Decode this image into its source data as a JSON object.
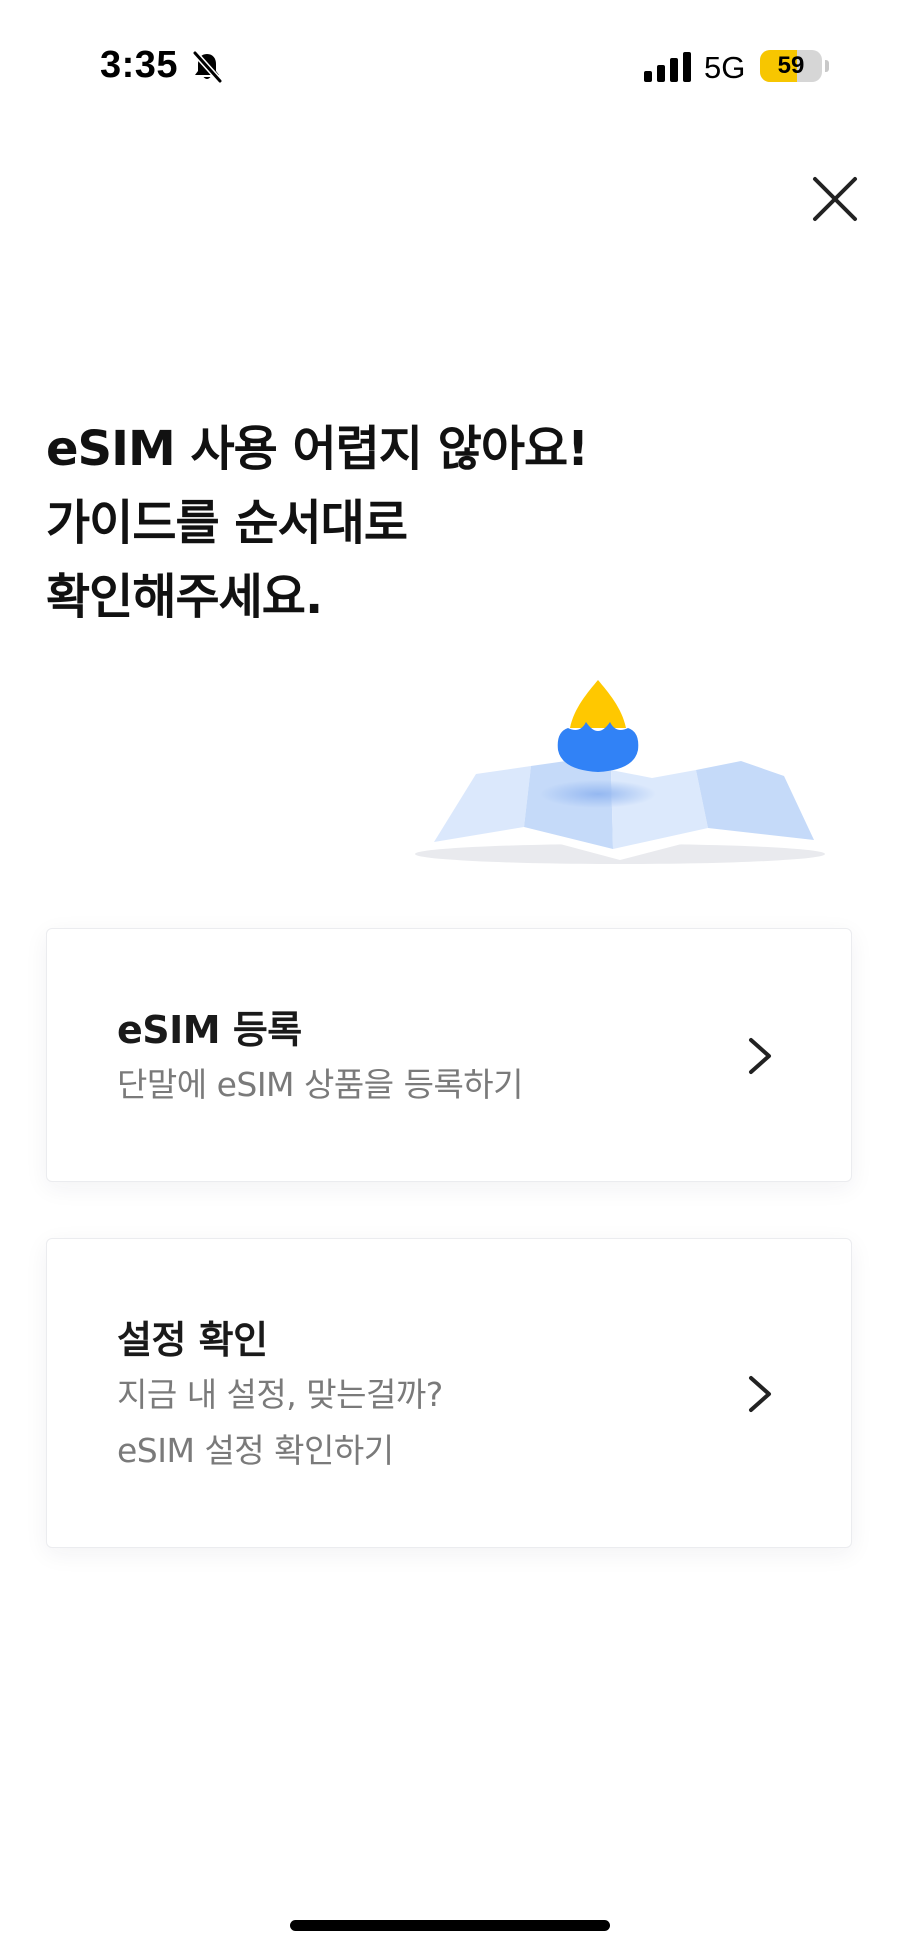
{
  "status_bar": {
    "time": "3:35",
    "network": "5G",
    "battery": "59",
    "battery_level": 0.59
  },
  "heading": {
    "line1": "eSIM 사용 어렵지 않아요!",
    "line2": "가이드를 순서대로",
    "line3": "확인해주세요."
  },
  "cards": [
    {
      "title": "eSIM 등록",
      "description": [
        "단말에 eSIM 상품을 등록하기"
      ]
    },
    {
      "title": "설정 확인",
      "description": [
        "지금 내 설정, 맞는걸까?",
        "eSIM 설정 확인하기"
      ]
    }
  ],
  "colors": {
    "accent_blue": "#3182f6",
    "accent_yellow": "#ffc800",
    "battery_yellow": "#f7c600",
    "description_gray": "#7a7a7a"
  },
  "icons": {
    "close": "close-icon",
    "chevron": "chevron-right-icon",
    "silent": "bell-off-icon",
    "signal": "signal-icon"
  }
}
